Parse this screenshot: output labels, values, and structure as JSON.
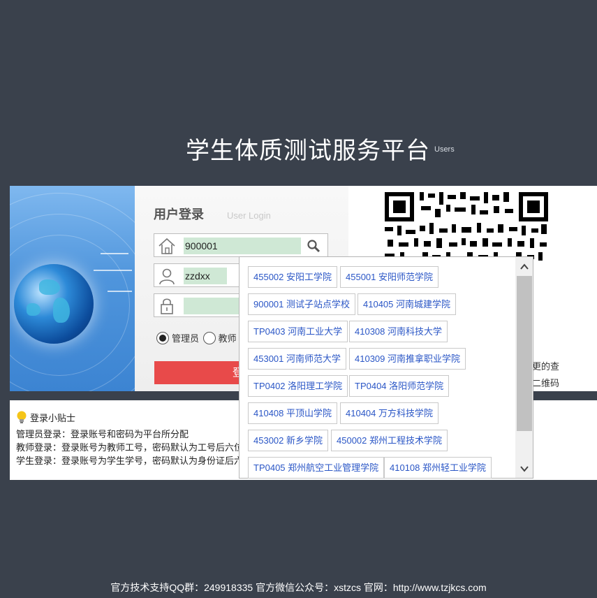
{
  "page": {
    "title": "学生体质测试服务平台",
    "title_sub": "Users"
  },
  "login": {
    "title": "用户登录",
    "subtitle": "User Login",
    "username_value": "900001",
    "account_value": "zzdxx",
    "password_value": "",
    "radio_admin_label": "管理员",
    "radio_teacher_label": "教师",
    "selected_role": "管理员",
    "login_button_label": "登"
  },
  "qr": {
    "text_line1": "更的查",
    "text_line2": "二维码"
  },
  "tips": {
    "title": "登录小贴士",
    "lines": [
      "管理员登录：登录账号和密码为平台所分配",
      "教师登录：登录账号为教师工号，密码默认为工号后六位",
      "学生登录：登录账号为学生学号，密码默认为身份证后六位"
    ]
  },
  "dropdown": {
    "options": [
      "455002 安阳工学院",
      "455001 安阳师范学院",
      "900001 测试子站点学校",
      "410405 河南城建学院",
      "TP0403 河南工业大学",
      "410308 河南科技大学",
      "453001 河南师范大学",
      "410309 河南推拿职业学院",
      "TP0402 洛阳理工学院",
      "TP0404 洛阳师范学院",
      "410408 平顶山学院",
      "410404 万方科技学院",
      "453002 新乡学院",
      "450002 郑州工程技术学院",
      "TP0405 郑州航空工业管理学院",
      "410108 郑州轻工业学院"
    ]
  },
  "footer": {
    "text": "官方技术支持QQ群：249918335  官方微信公众号：xstzcs  官网：http://www.tzjkcs.com"
  },
  "colors": {
    "background": "#3a414c",
    "login_button": "#e84a4a",
    "option_text": "#2a56c6",
    "field_fill": "#cfe8d5"
  },
  "icons": [
    "home-icon",
    "user-icon",
    "lock-icon",
    "search-icon",
    "bulb-icon",
    "chevron-up-icon",
    "chevron-down-icon"
  ]
}
